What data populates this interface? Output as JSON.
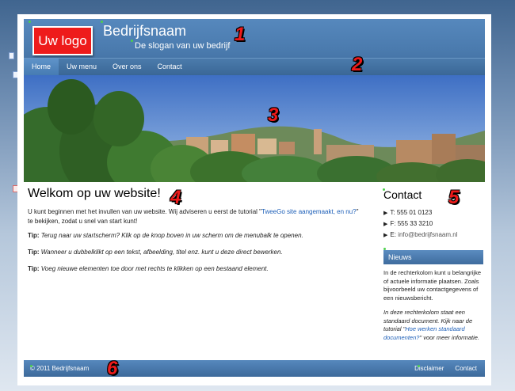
{
  "header": {
    "logo": "Uw logo",
    "company_name": "Bedrijfsnaam",
    "slogan": "De slogan van uw bedrijf"
  },
  "nav": {
    "items": [
      "Home",
      "Uw menu",
      "Over ons",
      "Contact"
    ],
    "active": "Home"
  },
  "main": {
    "title": "Welkom op uw website!",
    "intro_before": "U kunt beginnen met het invullen van uw website. Wij adviseren u eerst de tutorial  \"",
    "intro_link": "TweeGo site aangemaakt, en nu?",
    "intro_after": "\" te bekijken, zodat u snel van start kunt!",
    "tips": [
      {
        "label": "Tip:",
        "text": "Terug naar uw startscherm? Klik op de knop boven in uw scherm om de menubalk  te openen."
      },
      {
        "label": "Tip:",
        "text": "Wanneer u dubbelklikt op een tekst, afbeelding, titel enz. kunt u deze direct bewerken."
      },
      {
        "label": "Tip:",
        "text": "Voeg nieuwe elementen toe door met rechts te klikken op een bestaand element."
      }
    ]
  },
  "sidebar": {
    "contact_title": "Contact",
    "phone": "T:  555 01 0123",
    "fax": "F:  555 33 3210",
    "email_label": "E:",
    "email": "info@bedrijfsnaam.nl",
    "news_title": "Nieuws",
    "news_text": "In de rechterkolom kunt u belangrijke of actuele informatie plaatsen. Zoals bijvoorbeeld uw contactgegevens of een nieuwsbericht.",
    "note_before": "In deze rechterkolom staat een standaard document. Kijk naar de tutorial \"",
    "note_link": "Hoe werken standaard documenten?",
    "note_after": "\" voor meer informatie."
  },
  "footer": {
    "copyright": "© 2011 Bedrijfsnaam",
    "links": [
      "Disclaimer",
      "Contact"
    ]
  },
  "annotations": [
    "1",
    "2",
    "3",
    "4",
    "5",
    "6"
  ],
  "colors": {
    "header_blue": "#4a7aad",
    "logo_red": "#ee1b1b",
    "link_blue": "#1d5fb8",
    "annotation_red": "#ed1a1a"
  }
}
